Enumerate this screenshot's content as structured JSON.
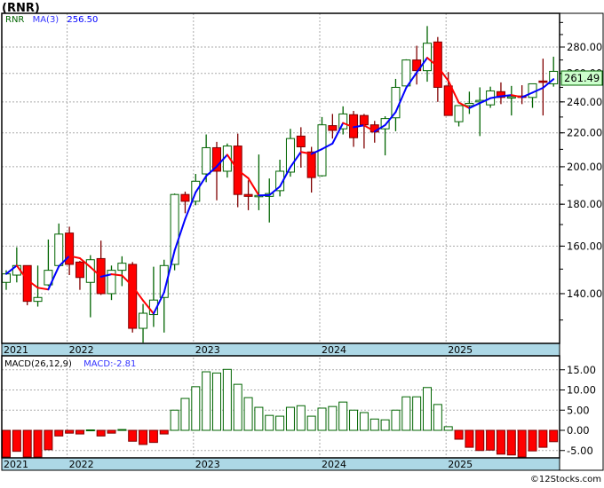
{
  "header": {
    "title": "(RNR)"
  },
  "legend": {
    "symbol": "RNR",
    "ma_label": "MA(3)",
    "ma_value": "256.50"
  },
  "macd_legend": {
    "label": "MACD(26,12,9)",
    "value": "MACD:-2.81"
  },
  "last_price": "261.49",
  "watermark": "©12Stocks.com",
  "colors": {
    "up": "#006400",
    "down": "#ff0000",
    "down_wick": "#800000",
    "ma_up": "#0000ff",
    "ma_down": "#ff0000",
    "date_band": "#add8e6",
    "last_price_bg": "#ccffcc"
  },
  "chart_data": [
    {
      "type": "candlestick",
      "title": "(RNR)",
      "scale": "log",
      "ylim": [
        120,
        300
      ],
      "yticks": [
        "140.00",
        "160.00",
        "180.00",
        "200.00",
        "220.00",
        "240.00",
        "260.00",
        "280.00"
      ],
      "ytick_values": [
        140,
        160,
        180,
        200,
        220,
        240,
        260,
        280
      ],
      "x_year_labels": [
        {
          "label": "2021",
          "index": 0
        },
        {
          "label": "2022",
          "index": 6
        },
        {
          "label": "2023",
          "index": 18
        },
        {
          "label": "2024",
          "index": 30
        },
        {
          "label": "2025",
          "index": 42
        }
      ],
      "grid": true,
      "overlay": {
        "name": "MA(3)",
        "period": 3
      },
      "candles_ohlc": [
        [
          144.5,
          149.5,
          141.5,
          148
        ],
        [
          147.5,
          159.5,
          144.5,
          151.5
        ],
        [
          151.5,
          151.5,
          135.5,
          137
        ],
        [
          137,
          151.5,
          135,
          138.5
        ],
        [
          143.5,
          163,
          143,
          149.5
        ],
        [
          151.5,
          170.5,
          151,
          165.5
        ],
        [
          166,
          169,
          147.5,
          152
        ],
        [
          153,
          153.5,
          141.5,
          146.5
        ],
        [
          144.5,
          156,
          131,
          154
        ],
        [
          154.5,
          162.5,
          139.5,
          140
        ],
        [
          140,
          151.5,
          137.5,
          149.5
        ],
        [
          149.5,
          155.5,
          143,
          152.5
        ],
        [
          152,
          153,
          125.5,
          127
        ],
        [
          127,
          136,
          122,
          132.5
        ],
        [
          132,
          151,
          127.5,
          137.5
        ],
        [
          138.5,
          154,
          125.5,
          151.5
        ],
        [
          152,
          185.5,
          149.5,
          185
        ],
        [
          185,
          186.5,
          175.5,
          181.5
        ],
        [
          181.5,
          196,
          179.5,
          192
        ],
        [
          196,
          219,
          191.5,
          211
        ],
        [
          211,
          214.5,
          182,
          197.5
        ],
        [
          197.5,
          213.5,
          194,
          212
        ],
        [
          212,
          219.5,
          178.5,
          185
        ],
        [
          185,
          192.5,
          177,
          184
        ],
        [
          184,
          207,
          177,
          184.5
        ],
        [
          184,
          193.5,
          171,
          185.5
        ],
        [
          187,
          204,
          184,
          197.5
        ],
        [
          197,
          222.5,
          194.5,
          216.5
        ],
        [
          218,
          223.5,
          199.5,
          211.5
        ],
        [
          208.5,
          211.5,
          186,
          194
        ],
        [
          195,
          230,
          194.5,
          225
        ],
        [
          224.5,
          232,
          216.5,
          221.5
        ],
        [
          222.5,
          237,
          219,
          232
        ],
        [
          231.5,
          234,
          211.5,
          217
        ],
        [
          231,
          232,
          210.5,
          225
        ],
        [
          225,
          227.5,
          214,
          220.5
        ],
        [
          222.5,
          230.5,
          206.5,
          229
        ],
        [
          229.5,
          256,
          221,
          250
        ],
        [
          251,
          270.5,
          250.5,
          270
        ],
        [
          270,
          281,
          252,
          262
        ],
        [
          262,
          297,
          254,
          283
        ],
        [
          284,
          288,
          240,
          250
        ],
        [
          251,
          261,
          231,
          231
        ],
        [
          227,
          237.5,
          224,
          237.5
        ],
        [
          237.5,
          247,
          232,
          239
        ],
        [
          240,
          250,
          218,
          241
        ],
        [
          238,
          250.5,
          236,
          247.5
        ],
        [
          247,
          253.5,
          238.5,
          243
        ],
        [
          243,
          251,
          231,
          243.5
        ],
        [
          244,
          251.5,
          238.5,
          243
        ],
        [
          243,
          252.5,
          236,
          252.5
        ],
        [
          254.5,
          271,
          231,
          253.5
        ],
        [
          252.5,
          272.5,
          250.5,
          261.49
        ]
      ]
    },
    {
      "type": "bar",
      "title": "MACD(26,12,9)",
      "ylim": [
        -6.8,
        18
      ],
      "yticks": [
        "-5.00",
        "0.00",
        "5.00",
        "10.00",
        "15.00"
      ],
      "ytick_values": [
        -5,
        0,
        5,
        10,
        15
      ],
      "x_year_labels": [
        {
          "label": "2021",
          "index": 0
        },
        {
          "label": "2022",
          "index": 6
        },
        {
          "label": "2023",
          "index": 18
        },
        {
          "label": "2024",
          "index": 30
        },
        {
          "label": "2025",
          "index": 42
        }
      ],
      "values": [
        -6.6,
        -5.2,
        -6.6,
        -6.6,
        -4.8,
        -1.4,
        -0.7,
        -0.9,
        0.1,
        -1.4,
        -0.7,
        0.2,
        -2.7,
        -3.5,
        -3.0,
        -0.9,
        5.0,
        7.9,
        10.8,
        14.5,
        14.2,
        15.1,
        11.4,
        8.1,
        5.7,
        3.7,
        3.5,
        5.7,
        6.1,
        3.5,
        5.5,
        5.9,
        7.0,
        5.0,
        4.4,
        2.8,
        2.6,
        5.0,
        8.3,
        8.3,
        10.6,
        6.4,
        0.9,
        -2.2,
        -4.2,
        -5.0,
        -4.9,
        -5.9,
        -6.1,
        -6.6,
        -5.1,
        -4.2,
        -2.81
      ]
    }
  ]
}
